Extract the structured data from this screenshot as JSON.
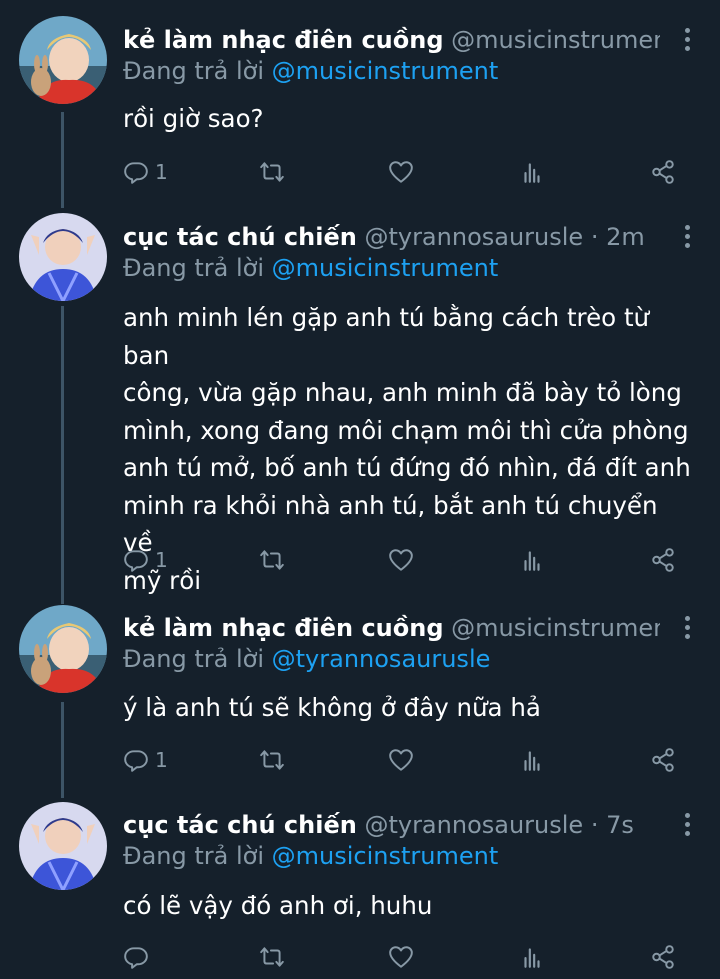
{
  "colors": {
    "background": "#15202b",
    "muted": "#8899a6",
    "link": "#1da1f2",
    "thread_line": "#3d5466"
  },
  "tweets": [
    {
      "name": "kẻ làm nhạc điên cuồng",
      "handle": "@musicinstrument ...",
      "reply_prefix": "Đang trả lời ",
      "reply_to": "@musicinstrument",
      "lines": [
        "rồi giờ sao?"
      ],
      "reply_count": "1",
      "avatar": "avatar-red-shirt"
    },
    {
      "name": "cục tác chú chiến",
      "handle": "@tyrannosaurusle · 2m",
      "reply_prefix": "Đang trả lời ",
      "reply_to": "@musicinstrument",
      "lines": [
        "anh minh lén gặp anh tú bằng cách trèo từ ban",
        "công, vừa gặp nhau, anh minh đã bày tỏ lòng",
        "mình, xong đang môi chạm môi thì cửa phòng",
        "anh tú mở, bố anh tú đứng đó nhìn, đá đít anh",
        "minh ra khỏi nhà anh tú, bắt anh tú chuyển về",
        "mỹ rồi"
      ],
      "reply_count": "1",
      "avatar": "avatar-blue-shirt"
    },
    {
      "name": "kẻ làm nhạc điên cuồng",
      "handle": "@musicinstrument ...",
      "reply_prefix": "Đang trả lời ",
      "reply_to": "@tyrannosaurusle",
      "lines": [
        "ý là anh tú sẽ không ở đây nữa hả"
      ],
      "reply_count": "1",
      "avatar": "avatar-red-shirt"
    },
    {
      "name": "cục tác chú chiến",
      "handle": "@tyrannosaurusle · 7s",
      "reply_prefix": "Đang trả lời ",
      "reply_to": "@musicinstrument",
      "lines": [
        "có lẽ vậy đó anh ơi, huhu"
      ],
      "reply_count": "",
      "avatar": "avatar-blue-shirt"
    }
  ],
  "icons": [
    "reply-icon",
    "retweet-icon",
    "like-icon",
    "analytics-icon",
    "share-icon",
    "more-icon"
  ]
}
